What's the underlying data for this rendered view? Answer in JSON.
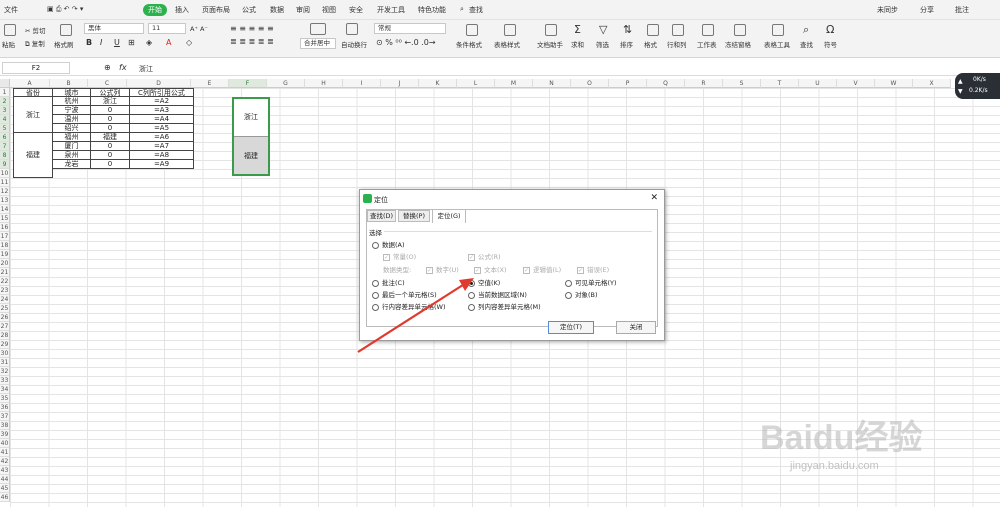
{
  "menu": {
    "file": "文件",
    "start": "开始",
    "items": [
      "插入",
      "页面布局",
      "公式",
      "数据",
      "审阅",
      "视图",
      "安全",
      "开发工具",
      "特色功能"
    ],
    "search": "查找",
    "sync": "未同步",
    "share": "分享",
    "comment": "批注"
  },
  "ribbon": {
    "paste": "粘贴",
    "cut": "剪切",
    "copy": "复制",
    "format_painter": "格式刷",
    "font": "黑体",
    "size": "11",
    "merge": "合并居中",
    "wrap": "自动换行",
    "numfmt": "常规",
    "cond": "条件格式",
    "table_style": "表格样式",
    "doc_helper": "文档助手",
    "sum": "求和",
    "filter": "筛选",
    "sort": "排序",
    "format": "格式",
    "rowcol": "行和列",
    "sheet": "工作表",
    "freeze": "冻结窗格",
    "table_tools": "表格工具",
    "find": "查找",
    "symbol": "符号"
  },
  "formula_bar": {
    "name_box": "F2",
    "fx": "fx",
    "value": "浙江"
  },
  "columns": [
    "A",
    "B",
    "C",
    "D",
    "E",
    "F",
    "G",
    "H",
    "I",
    "J",
    "K",
    "L",
    "M",
    "N",
    "O",
    "P",
    "Q",
    "R",
    "S",
    "T",
    "U",
    "V",
    "W",
    "X"
  ],
  "table": {
    "headers": [
      "省份",
      "城市",
      "公式列",
      "C列所引用公式"
    ],
    "provinces": [
      "浙江",
      "福建"
    ],
    "rows": [
      [
        "杭州",
        "浙江",
        "=A2"
      ],
      [
        "宁波",
        "0",
        "=A3"
      ],
      [
        "温州",
        "0",
        "=A4"
      ],
      [
        "绍兴",
        "0",
        "=A5"
      ],
      [
        "福州",
        "福建",
        "=A6"
      ],
      [
        "厦门",
        "0",
        "=A7"
      ],
      [
        "泉州",
        "0",
        "=A8"
      ],
      [
        "龙岩",
        "0",
        "=A9"
      ]
    ],
    "f_cells": [
      "浙江",
      "福建"
    ]
  },
  "net": {
    "up": "0K/s",
    "down": "0.2K/s"
  },
  "dialog": {
    "title": "定位",
    "tabs": [
      "查找(D)",
      "替换(P)",
      "定位(G)"
    ],
    "group": "选择",
    "data": "数据(A)",
    "constant": "常量(O)",
    "formula": "公式(R)",
    "data_type": "数据类型:",
    "number": "数字(U)",
    "text": "文本(X)",
    "logic": "逻辑值(L)",
    "error": "错误(E)",
    "note": "批注(C)",
    "blank": "空值(K)",
    "visible": "可见单元格(Y)",
    "last_cell": "最后一个单元格(S)",
    "current_region": "当前数据区域(N)",
    "object": "对象(B)",
    "row_diff": "行内容差异单元格(W)",
    "col_diff": "列内容差异单元格(M)",
    "ok": "定位(T)",
    "close": "关闭"
  },
  "watermark": "Baidu经验",
  "watermark_url": "jingyan.baidu.com",
  "colors": {
    "accent": "#2bb24c",
    "arrow": "#e03a2e"
  }
}
